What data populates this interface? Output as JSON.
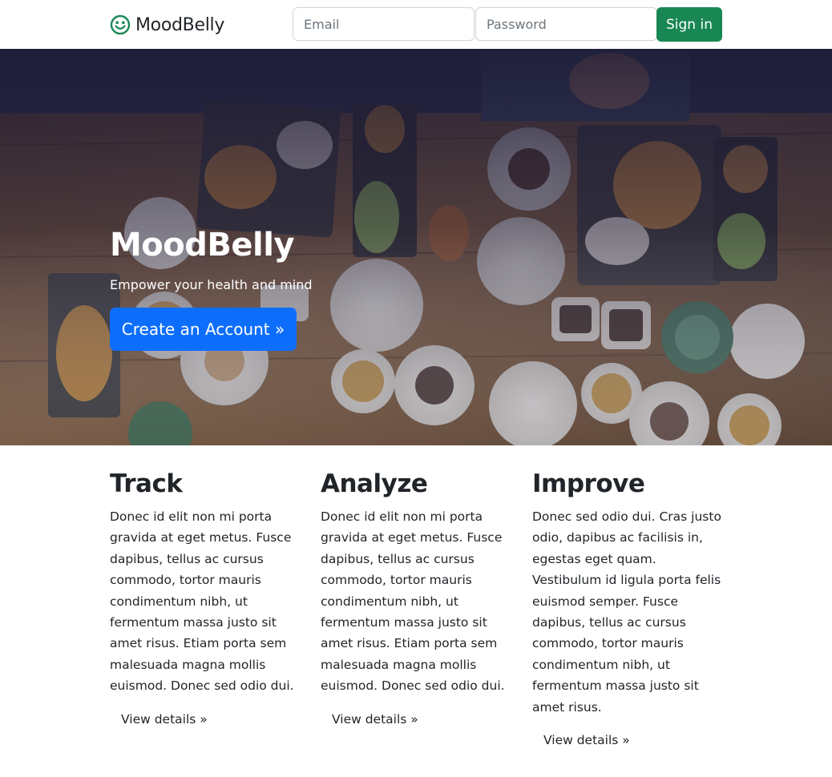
{
  "navbar": {
    "brand": "MoodBelly",
    "brand_icon": "smiley-icon",
    "email_placeholder": "Email",
    "password_placeholder": "Password",
    "signin_label": "Sign in",
    "colors": {
      "brand_icon": "#198754",
      "signin": "#198754"
    }
  },
  "hero": {
    "title": "MoodBelly",
    "subtitle": "Empower your health and mind",
    "cta_label": "Create an Account »",
    "background": "overhead photo of a table with food dishes, teapots and cups",
    "colors": {
      "cta": "#0d6efd"
    }
  },
  "features": [
    {
      "title": "Track",
      "text": "Donec id elit non mi porta gravida at eget metus. Fusce dapibus, tellus ac cursus commodo, tortor mauris condimentum nibh, ut fermentum massa justo sit amet risus. Etiam porta sem malesuada magna mollis euismod. Donec sed odio dui.",
      "link": "View details »"
    },
    {
      "title": "Analyze",
      "text": "Donec id elit non mi porta gravida at eget metus. Fusce dapibus, tellus ac cursus commodo, tortor mauris condimentum nibh, ut fermentum massa justo sit amet risus. Etiam porta sem malesuada magna mollis euismod. Donec sed odio dui.",
      "link": "View details »"
    },
    {
      "title": "Improve",
      "text": "Donec sed odio dui. Cras justo odio, dapibus ac facilisis in, egestas eget quam. Vestibulum id ligula porta felis euismod semper. Fusce dapibus, tellus ac cursus commodo, tortor mauris condimentum nibh, ut fermentum massa justo sit amet risus.",
      "link": "View details »"
    }
  ]
}
